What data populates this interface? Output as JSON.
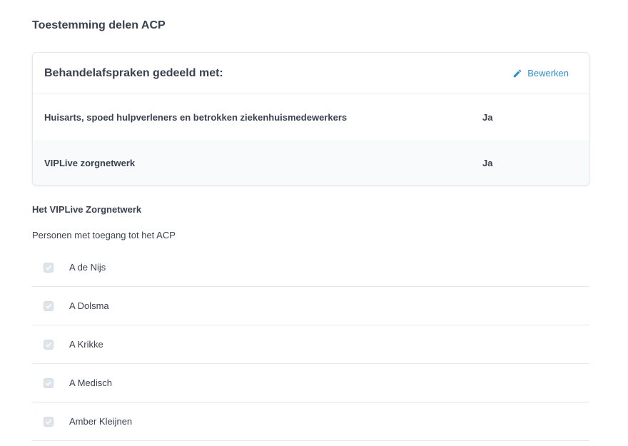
{
  "section_title": "Toestemming delen ACP",
  "card": {
    "title": "Behandelafspraken gedeeld met:",
    "edit_label": "Bewerken",
    "rows": [
      {
        "label": "Huisarts, spoed hulpverleners en betrokken ziekenhuismedewerkers",
        "value": "Ja"
      },
      {
        "label": "VIPLive zorgnetwerk",
        "value": "Ja"
      }
    ]
  },
  "network": {
    "title": "Het VIPLive Zorgnetwerk",
    "persons_label": "Personen met toegang tot het ACP",
    "persons": [
      {
        "name": "A de Nijs",
        "checked": true
      },
      {
        "name": "A Dolsma",
        "checked": true
      },
      {
        "name": "A Krikke",
        "checked": true
      },
      {
        "name": "A Medisch",
        "checked": true
      },
      {
        "name": "Amber Kleijnen",
        "checked": true
      }
    ]
  },
  "colors": {
    "accent": "#2b8fd6",
    "checkbox_fill": "#dfe4ea"
  },
  "icons": {
    "edit": "pencil-icon",
    "check": "check-icon"
  }
}
